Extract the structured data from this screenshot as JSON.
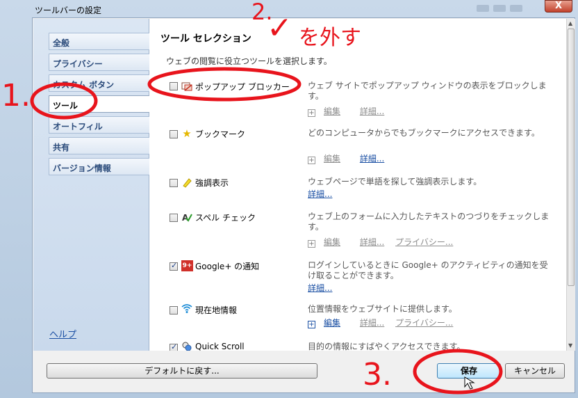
{
  "window": {
    "title": "ツールバーの設定",
    "close": "X"
  },
  "nav": {
    "items": [
      {
        "label": "全般"
      },
      {
        "label": "プライバシー"
      },
      {
        "label": "カスタム ボタン"
      },
      {
        "label": "ツール"
      },
      {
        "label": "オートフィル"
      },
      {
        "label": "共有"
      },
      {
        "label": "バージョン情報"
      }
    ],
    "active_index": 3,
    "help": "ヘルプ"
  },
  "content": {
    "title": "ツール セレクション",
    "subtitle": "ウェブの閲覧に役立つツールを選択します。",
    "tools": [
      {
        "name": "ポップアップ ブロッカー",
        "icon": "popup-blocker-icon",
        "checked": false,
        "desc": "ウェブ サイトでポップアップ ウィンドウの表示をブロックします。",
        "links": {
          "edit": "編集",
          "details": "詳細...",
          "privacy": ""
        }
      },
      {
        "name": "ブックマーク",
        "icon": "star-icon",
        "checked": false,
        "desc": "どのコンピュータからでもブックマークにアクセスできます。",
        "links": {
          "edit": "編集",
          "details": "詳細...",
          "privacy": ""
        }
      },
      {
        "name": "強調表示",
        "icon": "highlighter-icon",
        "checked": false,
        "desc": "ウェブページで単語を探して強調表示します。",
        "links": {
          "edit": "",
          "details": "詳細...",
          "privacy": ""
        }
      },
      {
        "name": "スペル チェック",
        "icon": "spellcheck-icon",
        "checked": false,
        "desc": "ウェブ上のフォームに入力したテキストのつづりをチェックします。",
        "links": {
          "edit": "編集",
          "details": "詳細...",
          "privacy": "プライバシー..."
        }
      },
      {
        "name": "Google+ の通知",
        "icon": "google-plus-icon",
        "checked": true,
        "desc": "ログインしているときに Google+ のアクティビティの通知を受け取ることができます。",
        "links": {
          "edit": "",
          "details": "詳細...",
          "privacy": ""
        }
      },
      {
        "name": "現在地情報",
        "icon": "wifi-location-icon",
        "checked": false,
        "desc": "位置情報をウェブサイトに提供します。",
        "links": {
          "edit": "編集",
          "details": "詳細...",
          "privacy": "プライバシー..."
        }
      },
      {
        "name": "Quick Scroll",
        "icon": "quick-scroll-icon",
        "checked": true,
        "desc": "目的の情報にすばやくアクセスできます。",
        "links": {
          "edit": "",
          "details": "",
          "privacy": ""
        }
      }
    ],
    "google_plus_badge": "9+"
  },
  "buttons": {
    "reset": "デフォルトに戻す...",
    "save": "保存",
    "cancel": "キャンセル"
  },
  "annotations": {
    "step1": "1.",
    "step2": "2.",
    "step3": "3.",
    "remove": "を外す",
    "checkmark": "✓"
  },
  "colors": {
    "annotation_red": "#e8141c",
    "link_blue": "#1a4fa3",
    "nav_bg": "#c9d9ec"
  }
}
